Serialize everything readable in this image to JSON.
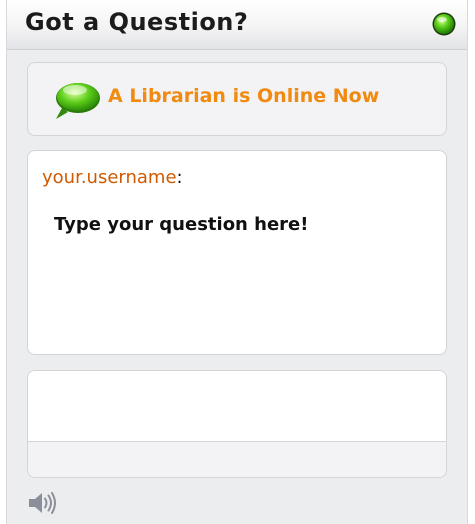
{
  "header": {
    "title": "Got a Question?",
    "status_icon": "green-online-orb-icon"
  },
  "status": {
    "icon": "green-speech-bubble-icon",
    "text": "A Librarian is Online Now",
    "color": "#f08a10"
  },
  "chat": {
    "username": "your.username",
    "separator": ":",
    "message": "Type your question here!",
    "username_color": "#d05a00"
  },
  "input": {
    "value": ""
  },
  "footer": {
    "sound_icon": "speaker-icon"
  },
  "colors": {
    "accent_green": "#4fbf1a",
    "panel_border": "#d3d4d8",
    "background": "#ecedef"
  }
}
